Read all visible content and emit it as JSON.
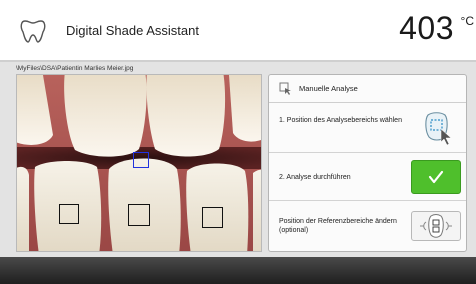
{
  "header": {
    "app_title": "Digital Shade Assistant",
    "temperature_value": "403",
    "temperature_unit": "°C"
  },
  "file_path": "\\MyFiles\\DSA\\Patientin Marlies Meier.jpg",
  "panel": {
    "title": "Manuelle Analyse",
    "steps": [
      {
        "label": "1. Position des Analysebereichs wählen"
      },
      {
        "label": "2. Analyse durchführen"
      },
      {
        "label": "Position der Referenzbereiche ändern (optional)"
      }
    ]
  },
  "colors": {
    "accent_green": "#4fbf2c",
    "analysis_marker": "#2233dd",
    "reference_marker": "#111111",
    "bottom_bar": "#2a2a2a"
  },
  "icons": {
    "header": "tooth-icon",
    "panel_header": "hand-pointer-icon",
    "step1": "tooth-select-icon",
    "step2": "check-icon",
    "step3": "reference-tooth-icon"
  }
}
